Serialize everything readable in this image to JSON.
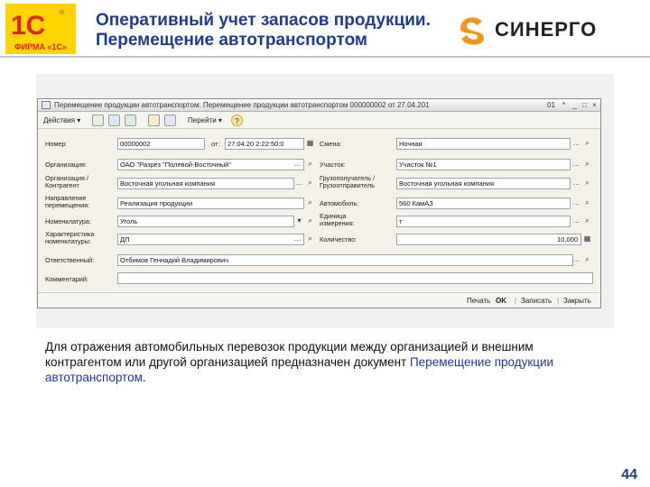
{
  "header": {
    "title_line1": "Оперативный учет запасов продукции.",
    "title_line2": "Перемещение автотранспортом",
    "logo_1c_text": "ФИРМА «1С»",
    "synergy_text": "СИНЕРГО",
    "colors": {
      "title": "#1f3a93",
      "logo_red": "#e1251b",
      "logo_yellow": "#ffd400",
      "synergy_orange": "#f7941d"
    }
  },
  "window": {
    "title": "Перемещение продукции автотранспортом: Перемещение продукции автотранспортом 000000002 от 27.04.201",
    "controls": [
      "01",
      "*",
      "_",
      "□",
      "×"
    ],
    "toolbar": {
      "actions_label": "Действия",
      "goto_label": "Перейти",
      "help_label": "?"
    },
    "fields": {
      "nomer_label": "Номер:",
      "nomer_value": "00000002",
      "ot_label": "от:",
      "ot_value": "27.04.20 2:22:50:0",
      "smena_label": "Смена:",
      "smena_value": "Ночная",
      "org_label": "Организация:",
      "org_value": "ОАО \"Разрез \"Полевой-Восточный\"",
      "uchastok_label": "Участок:",
      "uchastok_value": "Участок №1",
      "org_kontr_label_1": "Организация /",
      "org_kontr_label_2": "Контрагент",
      "org_kontr_value": "Восточная угольная компания",
      "gruzopol_label_1": "Грузополучатель /",
      "gruzopol_label_2": "Грузоотправитель",
      "gruzopol_value": "Восточная угольная компания",
      "napr_label_1": "Направление",
      "napr_label_2": "перемещения:",
      "napr_value": "Реализация продукции",
      "avto_label": "Автомобиль:",
      "avto_value": "560 КамАЗ",
      "nomenkl_label": "Номенклатура:",
      "nomenkl_value": "Уголь",
      "ed_izm_label_1": "Единица",
      "ed_izm_label_2": "измерения:",
      "ed_izm_value": "т",
      "harakt_label_1": "Характеристика",
      "harakt_label_2": "номенклатуры:",
      "harakt_value": "ДП",
      "kol_label": "Количество:",
      "kol_value": "10,000",
      "otv_label": "Ответственный:",
      "otv_value": "Отбимов Геннадий Владимирович",
      "comment_label": "Комментарий:",
      "comment_value": ""
    },
    "footer": {
      "print_label": "Печать",
      "ok_label": "OK",
      "save_label": "Записать",
      "close_label": "Закрыть"
    }
  },
  "description": {
    "text": "Для отражения автомобильных перевозок продукции между организацией и внешним контрагентом или другой организацией предназначен документ ",
    "strong": "Перемещение продукции автотранспортом",
    "tail": "."
  },
  "page_number": "44"
}
